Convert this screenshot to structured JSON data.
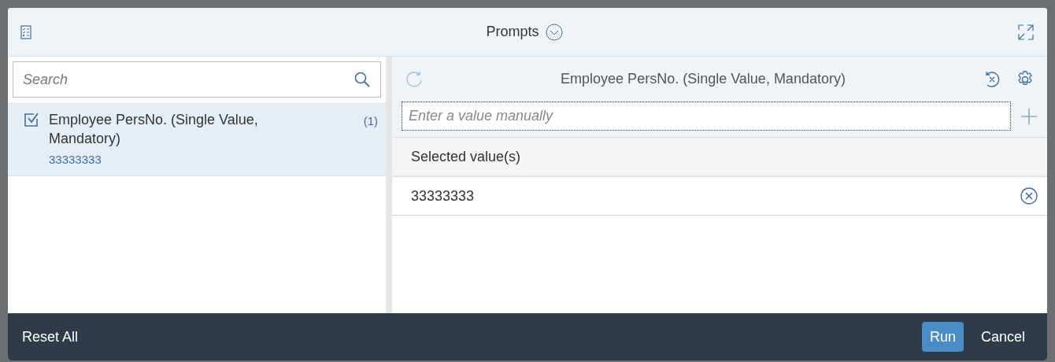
{
  "dialog": {
    "title": "Prompts"
  },
  "search": {
    "placeholder": "Search"
  },
  "prompts": [
    {
      "label": "Employee PersNo. (Single Value, Mandatory)",
      "count": "(1)",
      "value": "33333333",
      "selected": true,
      "checked": true
    }
  ],
  "detail": {
    "title": "Employee PersNo. (Single Value, Mandatory)",
    "input": {
      "placeholder": "Enter a value manually"
    },
    "selected_header": "Selected value(s)",
    "values": [
      "33333333"
    ]
  },
  "footer": {
    "reset": "Reset All",
    "buttons": [
      {
        "label": "Run",
        "kind": "primary"
      },
      {
        "label": "Cancel",
        "kind": "plain"
      }
    ]
  }
}
